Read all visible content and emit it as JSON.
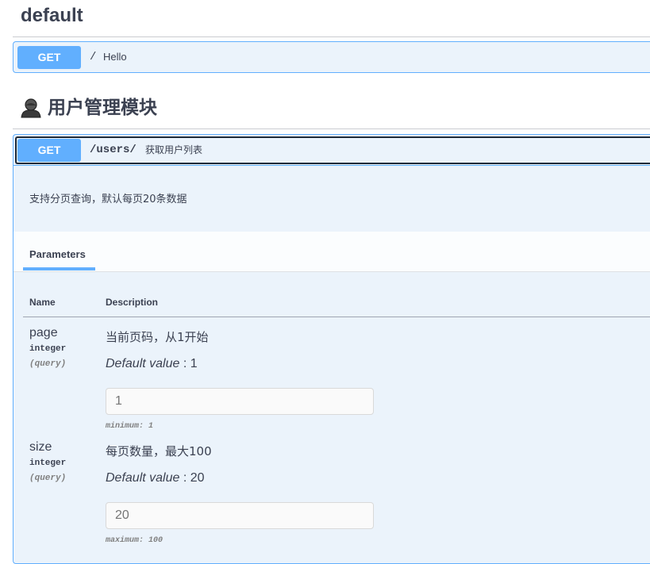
{
  "sections": {
    "default_title": "default",
    "tag_title": "用户管理模块"
  },
  "ops": [
    {
      "method": "GET",
      "path": "/",
      "summary": "Hello"
    },
    {
      "method": "GET",
      "path": "/users/",
      "summary": "获取用户列表"
    }
  ],
  "op_detail": {
    "description": "支持分页查询，默认每页20条数据",
    "tab_parameters": "Parameters",
    "col_name": "Name",
    "col_description": "Description",
    "params": [
      {
        "name": "page",
        "type": "integer",
        "in": "(query)",
        "description": "当前页码，从1开始",
        "default_label": "Default value",
        "default_sep": " : ",
        "default_value": "1",
        "input_placeholder": "1",
        "constraint": "minimum: 1"
      },
      {
        "name": "size",
        "type": "integer",
        "in": "(query)",
        "description": "每页数量，最大100",
        "default_label": "Default value",
        "default_sep": " : ",
        "default_value": "20",
        "input_placeholder": "20",
        "constraint": "maximum: 100"
      }
    ]
  },
  "colors": {
    "get": "#61affe",
    "get_bg": "#ebf3fb",
    "text": "#3b4151"
  },
  "icons": {
    "tag": "person-icon"
  }
}
